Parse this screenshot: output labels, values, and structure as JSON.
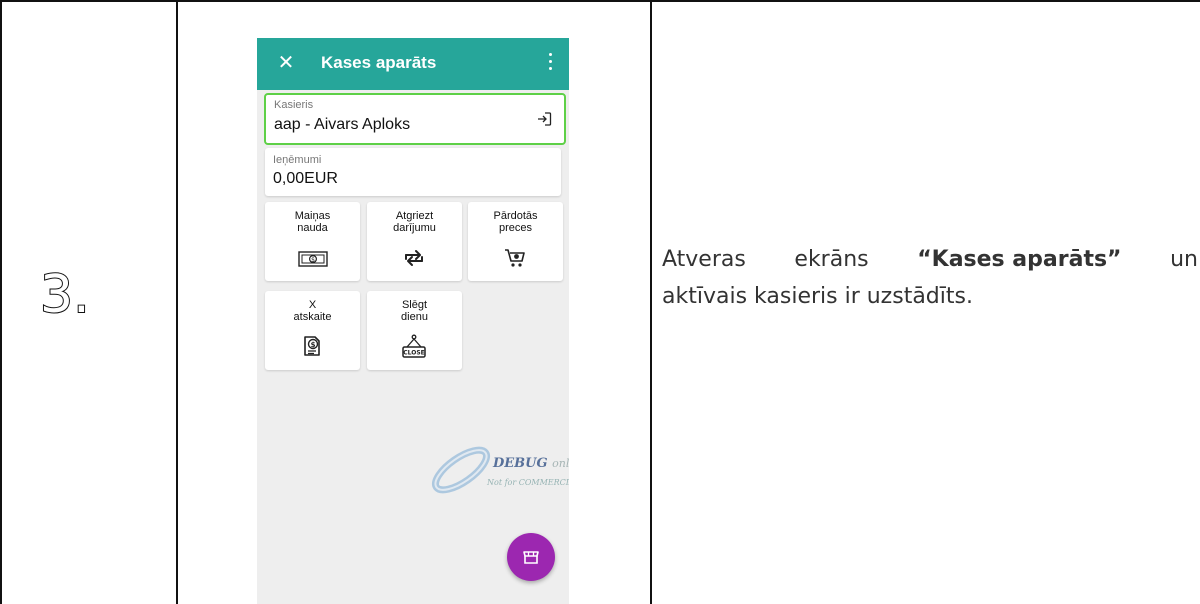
{
  "step": {
    "number": "3."
  },
  "phone": {
    "appbar": {
      "title": "Kases aparāts",
      "close_icon": "close-icon",
      "menu_icon": "more-vert-icon"
    },
    "cashier": {
      "label": "Kasieris",
      "value": "aap - Aivars Aploks",
      "icon": "login-icon"
    },
    "revenue": {
      "label": "Ieņēmumi",
      "value": "0,00EUR"
    },
    "tiles": [
      {
        "label": "Maiņas\nnauda",
        "icon": "cash-icon"
      },
      {
        "label": "Atgriezt\ndarījumu",
        "icon": "swap-icon"
      },
      {
        "label": "Pārdotās\npreces",
        "icon": "cart-icon"
      },
      {
        "label": "X\natskaite",
        "icon": "report-icon"
      },
      {
        "label": "Slēgt\ndienu",
        "icon": "close-sign-icon"
      }
    ],
    "watermark": {
      "line1": "DEBUG",
      "line1_suffix": "only",
      "line2": "Not for COMMERCIAL"
    },
    "fab": {
      "icon": "store-icon",
      "color": "#9c27b0"
    },
    "accent": "#26a69a",
    "highlight": "#5ed047"
  },
  "description": {
    "part1_a": "Atveras",
    "part1_b": "ekrāns",
    "bold": "“Kases aparāts”",
    "part1_c": "un",
    "part2": "aktīvais kasieris ir uzstādīts."
  }
}
